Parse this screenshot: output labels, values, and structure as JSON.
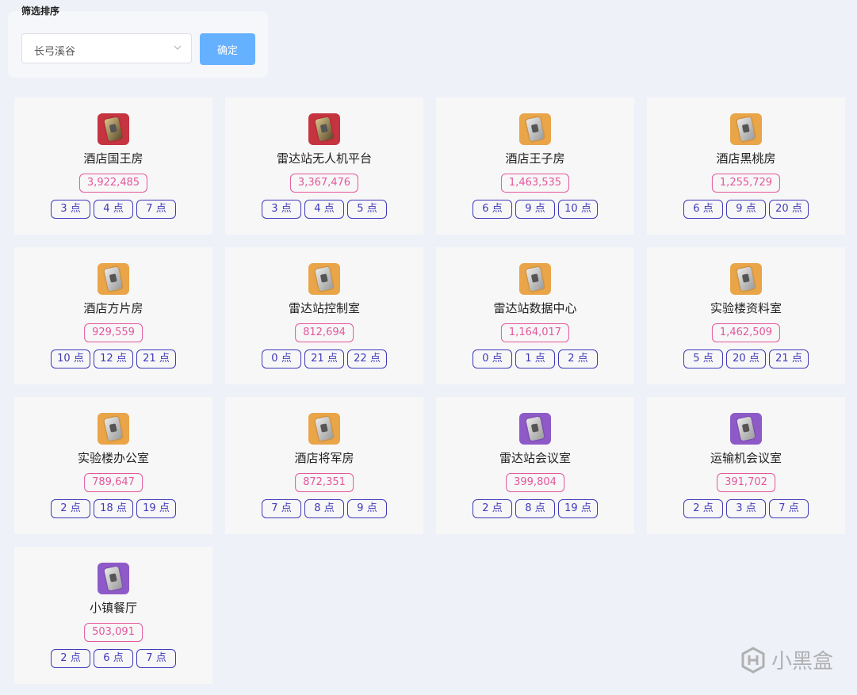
{
  "filter": {
    "title": "筛选排序",
    "selected_map": "长弓溪谷",
    "confirm_label": "确定"
  },
  "rooms": [
    {
      "name": "酒店国王房",
      "value": "3,922,485",
      "icon": "red",
      "points": [
        "3 点",
        "4 点",
        "7 点"
      ]
    },
    {
      "name": "雷达站无人机平台",
      "value": "3,367,476",
      "icon": "red",
      "points": [
        "3 点",
        "4 点",
        "5 点"
      ]
    },
    {
      "name": "酒店王子房",
      "value": "1,463,535",
      "icon": "orange",
      "points": [
        "6 点",
        "9 点",
        "10 点"
      ]
    },
    {
      "name": "酒店黑桃房",
      "value": "1,255,729",
      "icon": "orange",
      "points": [
        "6 点",
        "9 点",
        "20 点"
      ]
    },
    {
      "name": "酒店方片房",
      "value": "929,559",
      "icon": "orange",
      "points": [
        "10 点",
        "12 点",
        "21 点"
      ]
    },
    {
      "name": "雷达站控制室",
      "value": "812,694",
      "icon": "orange",
      "points": [
        "0 点",
        "21 点",
        "22 点"
      ]
    },
    {
      "name": "雷达站数据中心",
      "value": "1,164,017",
      "icon": "orange",
      "points": [
        "0 点",
        "1 点",
        "2 点"
      ]
    },
    {
      "name": "实验楼资料室",
      "value": "1,462,509",
      "icon": "orange",
      "points": [
        "5 点",
        "20 点",
        "21 点"
      ]
    },
    {
      "name": "实验楼办公室",
      "value": "789,647",
      "icon": "orange",
      "points": [
        "2 点",
        "18 点",
        "19 点"
      ]
    },
    {
      "name": "酒店将军房",
      "value": "872,351",
      "icon": "orange",
      "points": [
        "7 点",
        "8 点",
        "9 点"
      ]
    },
    {
      "name": "雷达站会议室",
      "value": "399,804",
      "icon": "purple",
      "points": [
        "2 点",
        "8 点",
        "19 点"
      ]
    },
    {
      "name": "运输机会议室",
      "value": "391,702",
      "icon": "purple",
      "points": [
        "2 点",
        "3 点",
        "7 点"
      ]
    },
    {
      "name": "小镇餐厅",
      "value": "503,091",
      "icon": "purple",
      "points": [
        "2 点",
        "6 点",
        "7 点"
      ]
    }
  ],
  "watermark": {
    "text": "小黑盒"
  },
  "colors": {
    "value_pink": "#e4579a",
    "point_indigo": "#3f3ab8",
    "confirm_blue": "#66b1ff"
  }
}
